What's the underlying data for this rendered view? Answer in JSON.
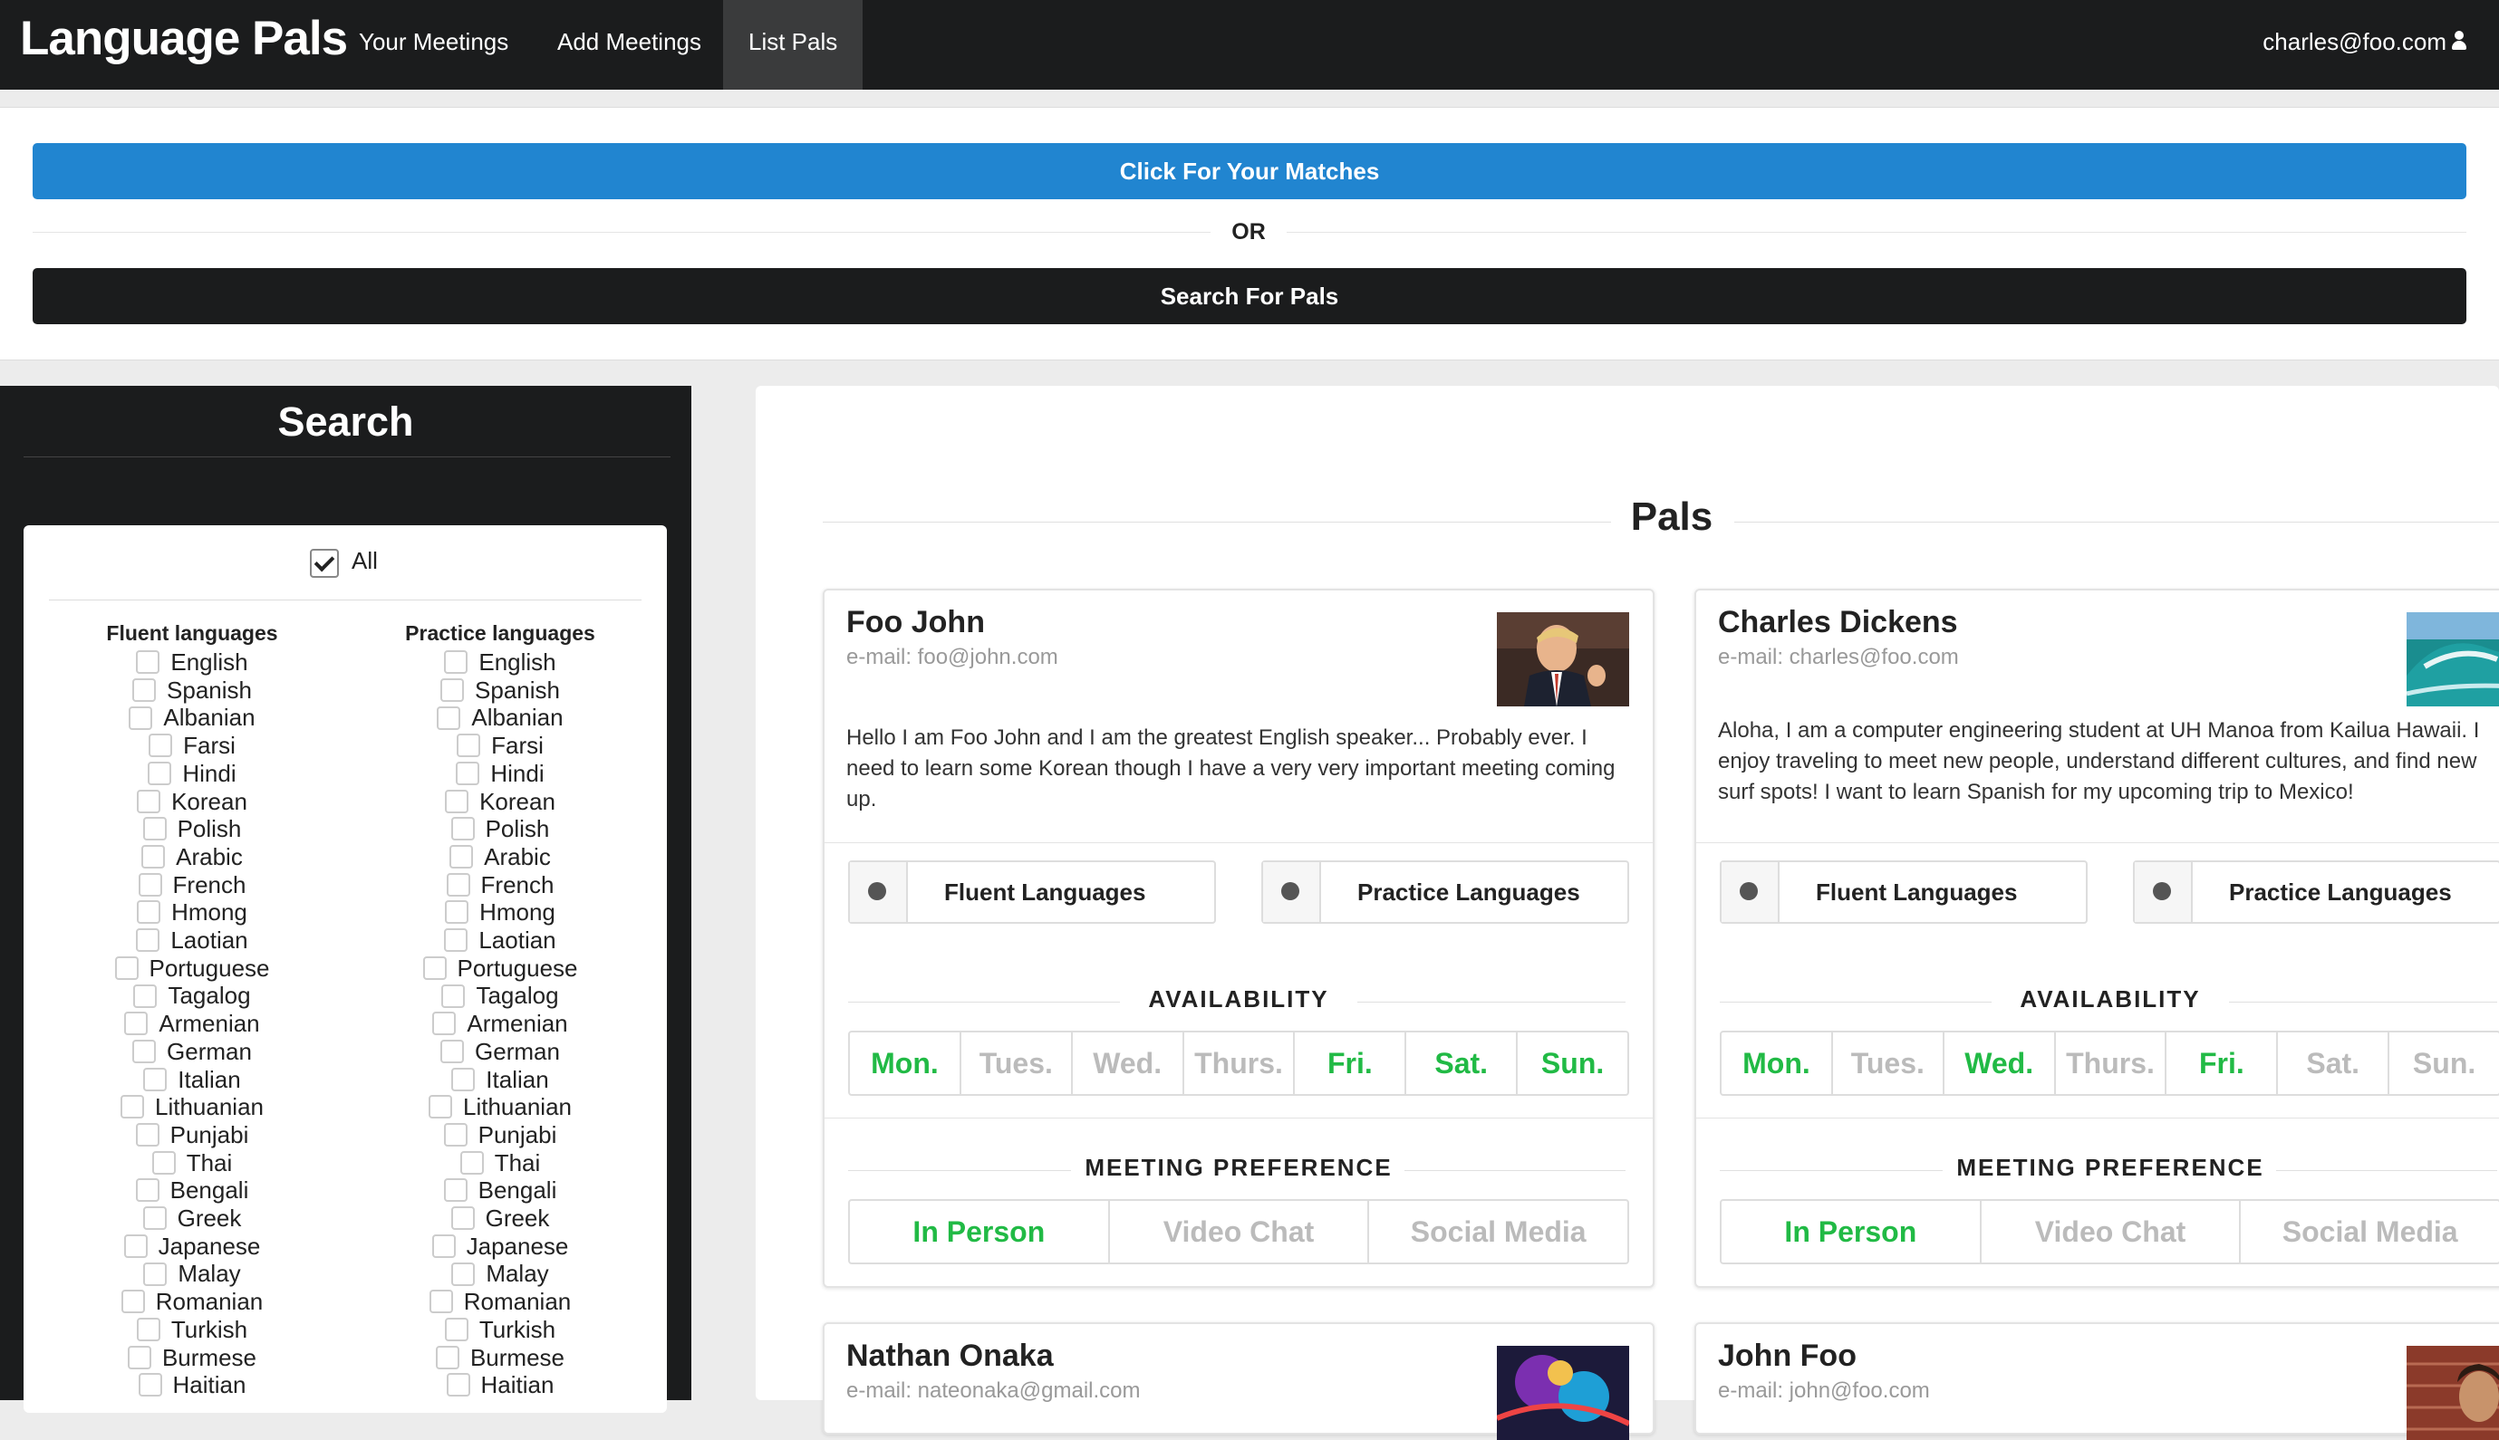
{
  "nav": {
    "brand": "Language Pals",
    "items": [
      "Your Meetings",
      "Add Meetings",
      "List Pals"
    ],
    "active": "List Pals",
    "user": "charles@foo.com",
    "user_icon": "user-icon"
  },
  "actions": {
    "matches_label": "Click For Your Matches",
    "or_label": "OR",
    "search_label": "Search For Pals",
    "accent_blue": "#2185d0",
    "accent_dark": "#1b1c1d"
  },
  "search": {
    "title": "Search",
    "all_label": "All",
    "all_checked": true,
    "fluent_heading": "Fluent languages",
    "practice_heading": "Practice languages",
    "languages": [
      "English",
      "Spanish",
      "Albanian",
      "Farsi",
      "Hindi",
      "Korean",
      "Polish",
      "Arabic",
      "French",
      "Hmong",
      "Laotian",
      "Portuguese",
      "Tagalog",
      "Armenian",
      "German",
      "Italian",
      "Lithuanian",
      "Punjabi",
      "Thai",
      "Bengali",
      "Greek",
      "Japanese",
      "Malay",
      "Romanian",
      "Turkish",
      "Burmese",
      "Haitian"
    ]
  },
  "pals": {
    "title": "Pals",
    "fluent_button": "Fluent Languages",
    "practice_button": "Practice Languages",
    "availability_heading": "AVAILABILITY",
    "meeting_heading": "MEETING PREFERENCE",
    "days": [
      "Mon.",
      "Tues.",
      "Wed.",
      "Thurs.",
      "Fri.",
      "Sat.",
      "Sun."
    ],
    "prefs": [
      "In Person",
      "Video Chat",
      "Social Media"
    ],
    "active_color": "#21ba45",
    "cards": [
      {
        "name": "Foo John",
        "email": "e-mail: foo@john.com",
        "bio": "Hello I am Foo John and I am the greatest English speaker... Probably ever. I need to learn some Korean though I have a very very important meeting coming up.",
        "days_on": [
          true,
          false,
          false,
          false,
          true,
          true,
          true
        ],
        "prefs_on": [
          true,
          false,
          false
        ]
      },
      {
        "name": "Charles Dickens",
        "email": "e-mail: charles@foo.com",
        "bio": "Aloha, I am a computer engineering student at UH Manoa from Kailua Hawaii. I enjoy traveling to meet new people, understand different cultures, and find new surf spots! I want to learn Spanish for my upcoming trip to Mexico!",
        "days_on": [
          true,
          false,
          true,
          false,
          true,
          false,
          false
        ],
        "prefs_on": [
          true,
          false,
          false
        ]
      },
      {
        "name": "Nathan Onaka",
        "email": "e-mail: nateonaka@gmail.com"
      },
      {
        "name": "John Foo",
        "email": "e-mail: john@foo.com"
      }
    ]
  }
}
